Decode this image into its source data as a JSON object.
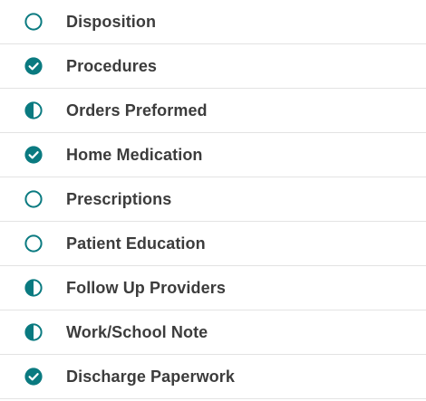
{
  "accent_color": "#0a7a80",
  "items": [
    {
      "label": "Disposition",
      "status": "empty",
      "icon": "circle-outline-icon"
    },
    {
      "label": "Procedures",
      "status": "complete",
      "icon": "check-circle-icon"
    },
    {
      "label": "Orders Preformed",
      "status": "partial",
      "icon": "half-circle-icon"
    },
    {
      "label": "Home Medication",
      "status": "complete",
      "icon": "check-circle-icon"
    },
    {
      "label": "Prescriptions",
      "status": "empty",
      "icon": "circle-outline-icon"
    },
    {
      "label": "Patient Education",
      "status": "empty",
      "icon": "circle-outline-icon"
    },
    {
      "label": "Follow Up Providers",
      "status": "partial",
      "icon": "half-circle-icon"
    },
    {
      "label": "Work/School Note",
      "status": "partial",
      "icon": "half-circle-icon"
    },
    {
      "label": "Discharge Paperwork",
      "status": "complete",
      "icon": "check-circle-icon"
    }
  ]
}
